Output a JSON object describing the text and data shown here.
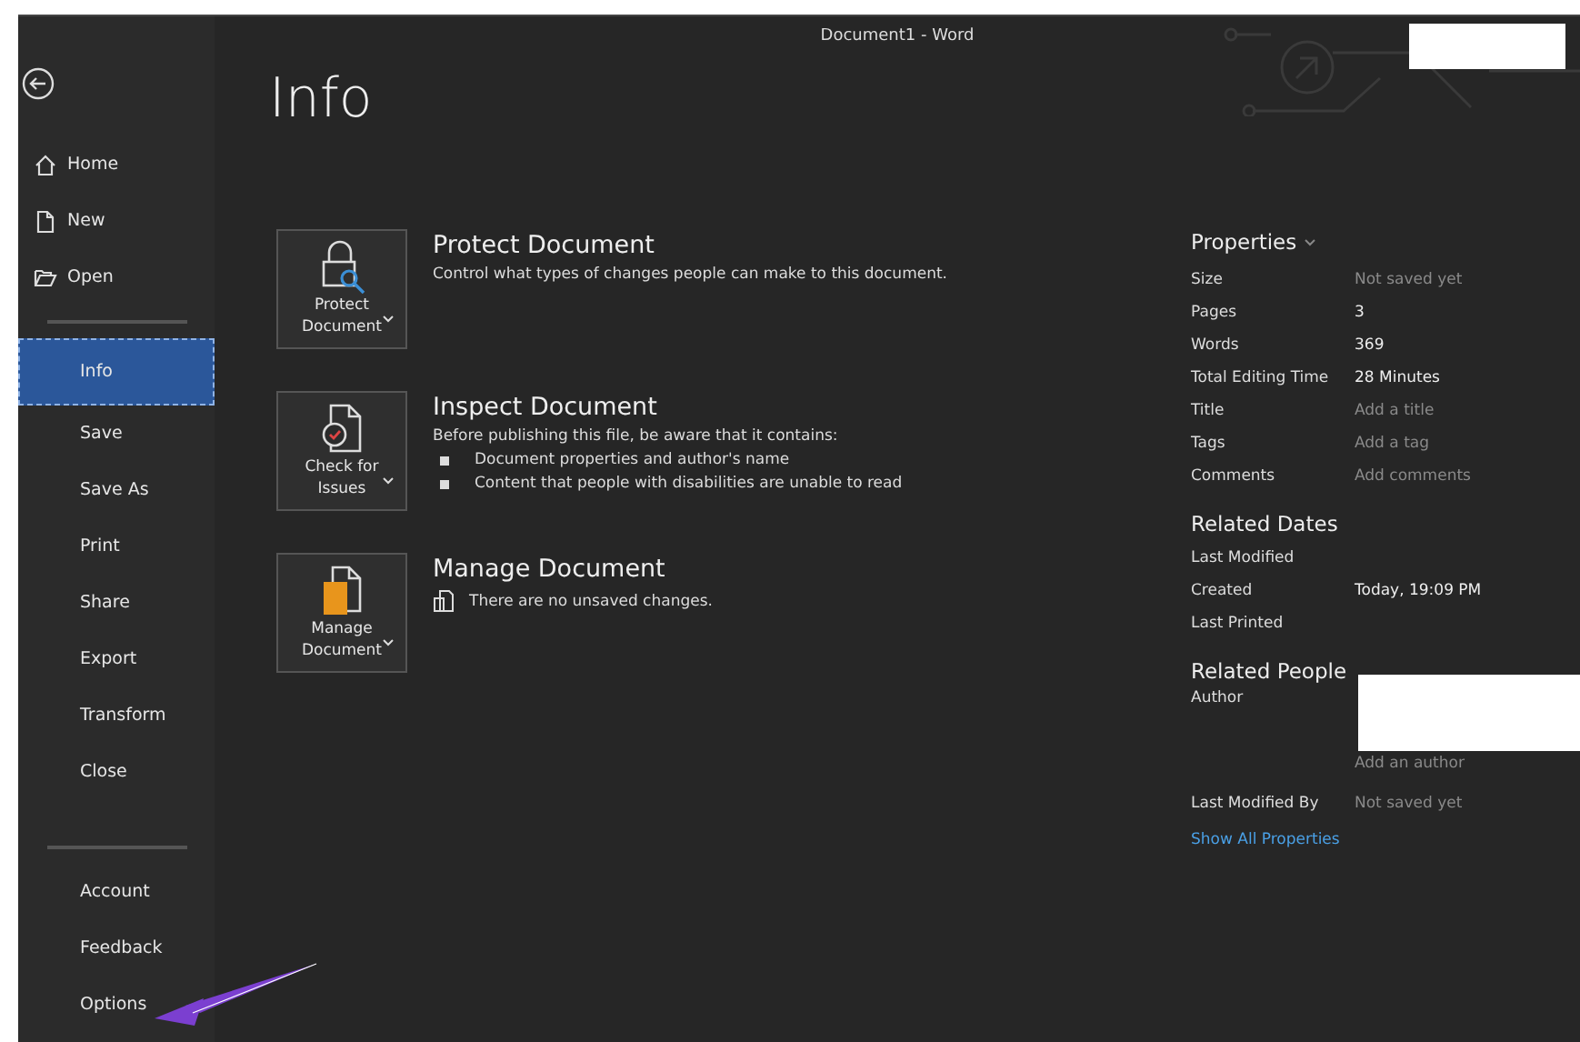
{
  "window": {
    "title": "Document1  -  Word"
  },
  "sidebar": {
    "top_items": [
      {
        "label": "Home",
        "selected": false
      },
      {
        "label": "New",
        "selected": false
      },
      {
        "label": "Open",
        "selected": false
      }
    ],
    "items": [
      {
        "label": "Info",
        "selected": true
      },
      {
        "label": "Save",
        "selected": false
      },
      {
        "label": "Save As",
        "selected": false
      },
      {
        "label": "Print",
        "selected": false
      },
      {
        "label": "Share",
        "selected": false
      },
      {
        "label": "Export",
        "selected": false
      },
      {
        "label": "Transform",
        "selected": false
      },
      {
        "label": "Close",
        "selected": false
      }
    ],
    "bottom_items": [
      {
        "label": "Account",
        "selected": false
      },
      {
        "label": "Feedback",
        "selected": false
      },
      {
        "label": "Options",
        "selected": false
      }
    ]
  },
  "page_title": "Info",
  "sections": [
    {
      "button": [
        "Protect",
        "Document"
      ],
      "title": "Protect Document",
      "description": "Control what types of changes people can make to this document."
    },
    {
      "button": [
        "Check for",
        "Issues"
      ],
      "title": "Inspect Document",
      "description": "Before publishing this file, be aware that it contains:",
      "bullets": [
        "Document properties and author's name",
        "Content that people with disabilities are unable to read"
      ]
    },
    {
      "button": [
        "Manage",
        "Document"
      ],
      "title": "Manage Document",
      "note": "There are no unsaved changes."
    }
  ],
  "properties": {
    "heading": "Properties",
    "rows": [
      {
        "label": "Size",
        "value": "Not saved yet",
        "empty": true
      },
      {
        "label": "Pages",
        "value": "3",
        "empty": false
      },
      {
        "label": "Words",
        "value": "369",
        "empty": false
      },
      {
        "label": "Total Editing Time",
        "value": "28 Minutes",
        "empty": false
      },
      {
        "label": "Title",
        "value": "Add a title",
        "empty": true
      },
      {
        "label": "Tags",
        "value": "Add a tag",
        "empty": true
      },
      {
        "label": "Comments",
        "value": "Add comments",
        "empty": true
      }
    ]
  },
  "related_dates": {
    "heading": "Related Dates",
    "rows": [
      {
        "label": "Last Modified"
      },
      {
        "label": "Created",
        "value": "Today, 19:09 PM"
      },
      {
        "label": "Last Printed"
      }
    ]
  },
  "related_people": {
    "heading": "Related People",
    "author_label": "Author",
    "add_author": "Add an author",
    "last_modified_by": {
      "label": "Last Modified By",
      "value": "Not saved yet",
      "empty": true
    }
  },
  "show_all": "Show All Properties"
}
